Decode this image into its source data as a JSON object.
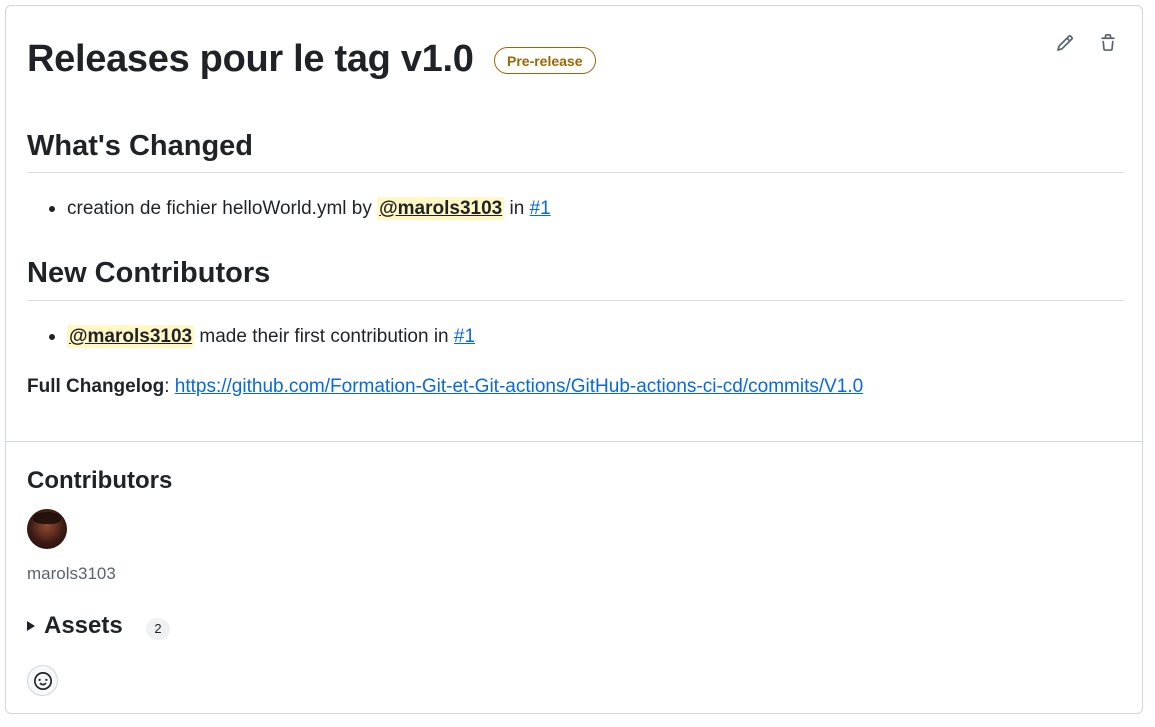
{
  "release": {
    "title": "Releases pour le tag v1.0",
    "badge": "Pre-release",
    "actions": {
      "edit_icon": "pencil-icon",
      "delete_icon": "trash-icon"
    }
  },
  "body": {
    "whats_changed": {
      "heading": "What's Changed",
      "items": [
        {
          "text_before": "creation de fichier helloWorld.yml by ",
          "mention": "@marols3103",
          "text_middle": " in ",
          "link": "#1"
        }
      ]
    },
    "new_contributors": {
      "heading": "New Contributors",
      "items": [
        {
          "mention": "@marols3103",
          "text_middle": " made their first contribution in ",
          "link": "#1"
        }
      ]
    },
    "changelog": {
      "label": "Full Changelog",
      "separator": ": ",
      "url": "https://github.com/Formation-Git-et-Git-actions/GitHub-actions-ci-cd/commits/V1.0"
    }
  },
  "contributors": {
    "heading": "Contributors",
    "users": [
      {
        "name": "marols3103"
      }
    ]
  },
  "assets": {
    "label": "Assets",
    "count": "2"
  },
  "reaction": {
    "icon": "smiley-icon"
  },
  "colors": {
    "text": "#1f2328",
    "link": "#0969da",
    "badge": "#9a6700",
    "mention_bg": "#fff8c5",
    "border": "#d0d7de"
  }
}
